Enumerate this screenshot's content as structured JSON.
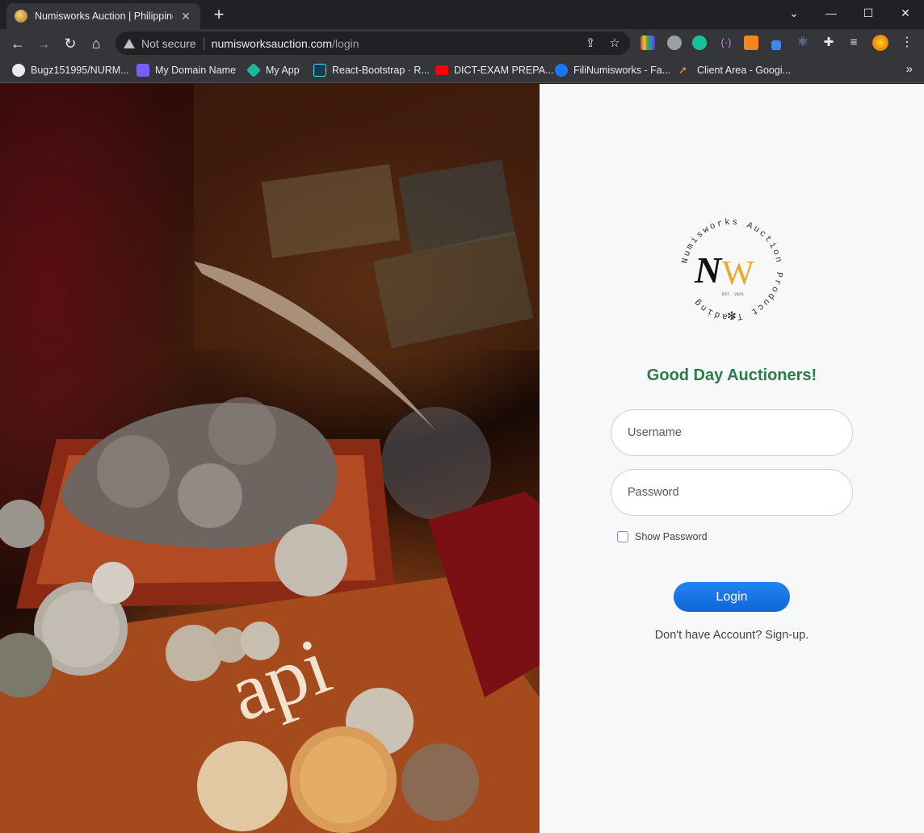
{
  "browser": {
    "tab": {
      "title": "Numisworks Auction | Philippines",
      "close": "✕"
    },
    "new_tab": "+",
    "window_controls": {
      "minimize": "—",
      "maximize": "☐",
      "close": "✕",
      "dropdown": "⌄"
    },
    "nav": {
      "back": "←",
      "forward": "→",
      "reload": "↻",
      "home": "⌂"
    },
    "omnibox": {
      "security": "Not secure",
      "host": "numisworksauction.com",
      "path": "/login"
    },
    "bookmarks": [
      {
        "label": "Bugz151995/NURM...",
        "icon": "github-icon",
        "color": "#e8eaed"
      },
      {
        "label": "My Domain Name",
        "icon": "domain-icon",
        "color": "#7b5cff"
      },
      {
        "label": "My App",
        "icon": "app-icon",
        "color": "#18b9a0"
      },
      {
        "label": "React-Bootstrap · R...",
        "icon": "react-bootstrap-icon",
        "color": "#41e0fd"
      },
      {
        "label": "DICT-EXAM PREPA...",
        "icon": "youtube-icon",
        "color": "#ff0000"
      },
      {
        "label": "FiliNumisworks - Fa...",
        "icon": "facebook-icon",
        "color": "#1877f2"
      },
      {
        "label": "Client Area - Googi...",
        "icon": "rocket-icon",
        "color": "#f5a623"
      }
    ],
    "bookmarks_more": "»"
  },
  "page": {
    "logo": {
      "ring_text": "Numisworks Auction Product Trading",
      "monogram": "NW",
      "est": "EST. 2021"
    },
    "greeting": "Good Day Auctioners!",
    "username": {
      "placeholder": "Username"
    },
    "password": {
      "placeholder": "Password"
    },
    "show_password": "Show Password",
    "login_button": "Login",
    "signup_text": "Don't have Account? Sign-up."
  },
  "colors": {
    "greeting": "#2d7a4a",
    "login_button": "#1a73e8",
    "login_bg": "#f7f8fa"
  }
}
